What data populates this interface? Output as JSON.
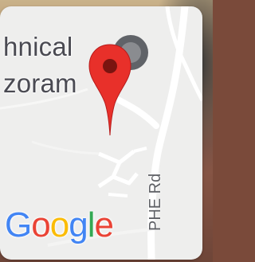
{
  "map": {
    "place_label_lines": [
      "hnical",
      "zoram"
    ],
    "road_label": "PHE Rd",
    "logo_text": "Google",
    "logo_colors": [
      "#4285F4",
      "#EA4335",
      "#FBBC05",
      "#4285F4",
      "#34A853",
      "#EA4335"
    ],
    "pin_color": "#E8302A",
    "pin_dot_color": "#7A1410",
    "poi_icon_color": "#606368",
    "road_color": "#ffffff",
    "land_color": "#eeeeed"
  }
}
